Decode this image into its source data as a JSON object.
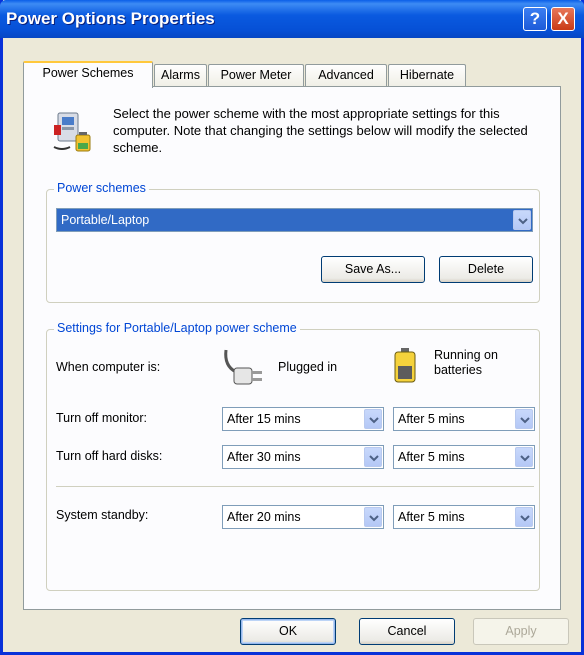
{
  "window": {
    "title": "Power Options Properties"
  },
  "titlebar": {
    "help_glyph": "?",
    "close_glyph": "X"
  },
  "tabs": [
    {
      "label": "Power Schemes",
      "active": true
    },
    {
      "label": "Alarms"
    },
    {
      "label": "Power Meter"
    },
    {
      "label": "Advanced"
    },
    {
      "label": "Hibernate"
    }
  ],
  "description": "Select the power scheme with the most appropriate settings for this computer. Note that changing the settings below will modify the selected scheme.",
  "power_schemes": {
    "legend": "Power schemes",
    "selected": "Portable/Laptop",
    "save_as_label": "Save As...",
    "delete_label": "Delete"
  },
  "settings": {
    "legend": "Settings for Portable/Laptop power scheme",
    "when_label": "When computer is:",
    "plugged_label": "Plugged in",
    "battery_label": "Running on batteries",
    "rows": [
      {
        "label": "Turn off monitor:",
        "plugged": "After 15 mins",
        "battery": "After 5 mins"
      },
      {
        "label": "Turn off hard disks:",
        "plugged": "After 30 mins",
        "battery": "After 5 mins"
      },
      {
        "label": "System standby:",
        "plugged": "After 20 mins",
        "battery": "After 5 mins"
      }
    ]
  },
  "footer": {
    "ok_label": "OK",
    "cancel_label": "Cancel",
    "apply_label": "Apply"
  },
  "icons": {
    "scheme": "power-scheme-icon",
    "plug": "power-plug-icon",
    "battery": "battery-icon",
    "dropdown": "chevron-down-icon"
  }
}
